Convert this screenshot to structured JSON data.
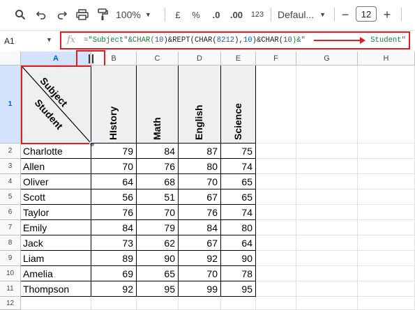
{
  "toolbar": {
    "zoom": "100%",
    "currency": "£",
    "percent": "%",
    "dec_less": ".0",
    "dec_more": ".00",
    "number_fmt": "123",
    "font": "Defaul...",
    "font_size": "12",
    "minus": "−",
    "plus": "+"
  },
  "formula_bar": {
    "name_box": "A1",
    "fx": "fx",
    "formula_p1": "=\"Subject\"&CHAR(",
    "formula_n1": "10",
    "formula_p2": ")&REPT(CHAR(",
    "formula_n2": "8212",
    "formula_p3": "),",
    "formula_n3": "10",
    "formula_p4": ")&CHAR(",
    "formula_n4": "10",
    "formula_p5": ")&\"",
    "formula_end": "Student\""
  },
  "columns": [
    "A",
    "B",
    "C",
    "D",
    "E",
    "F",
    "G",
    "H"
  ],
  "row_numbers": [
    "1",
    "2",
    "3",
    "4",
    "5",
    "6",
    "7",
    "8",
    "9",
    "10",
    "11",
    "12"
  ],
  "header": {
    "diag_top": "Subject",
    "diag_bottom": "Student",
    "subjects": [
      "HIstory",
      "Math",
      "English",
      "Science"
    ]
  },
  "rows": [
    {
      "name": "Charlotte",
      "values": [
        "79",
        "84",
        "87",
        "75"
      ]
    },
    {
      "name": "Allen",
      "values": [
        "70",
        "76",
        "80",
        "74"
      ]
    },
    {
      "name": "Oliver",
      "values": [
        "64",
        "68",
        "70",
        "65"
      ]
    },
    {
      "name": "Scott",
      "values": [
        "56",
        "51",
        "67",
        "65"
      ]
    },
    {
      "name": "Taylor",
      "values": [
        "76",
        "70",
        "76",
        "74"
      ]
    },
    {
      "name": "Emily",
      "values": [
        "84",
        "79",
        "84",
        "80"
      ]
    },
    {
      "name": "Jack",
      "values": [
        "73",
        "62",
        "67",
        "64"
      ]
    },
    {
      "name": "Liam",
      "values": [
        "89",
        "90",
        "92",
        "90"
      ]
    },
    {
      "name": "Amelia",
      "values": [
        "69",
        "65",
        "70",
        "78"
      ]
    },
    {
      "name": "Thompson",
      "values": [
        "92",
        "95",
        "99",
        "95"
      ]
    }
  ],
  "colors": {
    "annotation": "#e02020",
    "selected_header": "#d3e3fd",
    "formula_string": "#188038",
    "formula_number": "#1155cc"
  }
}
